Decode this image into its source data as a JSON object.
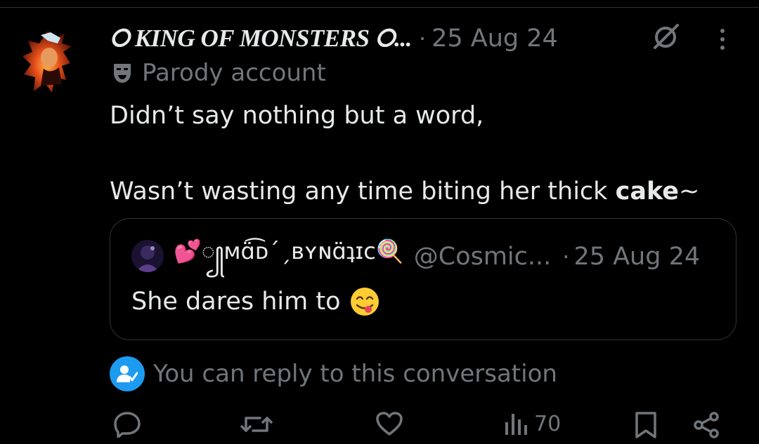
{
  "post": {
    "author_name": "⭘ KING OF MONSTERS ⭘...",
    "separator": "·",
    "date": "25 Aug 24",
    "badge_label": "Parody account",
    "text_line1": "Didn’t say nothing but a word,",
    "text_line2_pre": "Wasn’t wasting any time biting her thick ",
    "text_line2_bold": "cake",
    "text_line2_post": "~"
  },
  "quote": {
    "name": "💕꧀ᴍɑ̈͡ᴅ´ˏʙʏɴɑ̈ʇɪᴄ🍭",
    "handle": "@Cosmic...",
    "separator": "·",
    "date": "25 Aug 24",
    "text": "She dares him to"
  },
  "reply_notice": "You can reply to this conversation",
  "actions": {
    "views_count": "70"
  },
  "colors": {
    "background": "#000000",
    "text_primary": "#e7e9ea",
    "text_secondary": "#71767b",
    "accent": "#1d9bf0",
    "border": "#2f3336"
  }
}
